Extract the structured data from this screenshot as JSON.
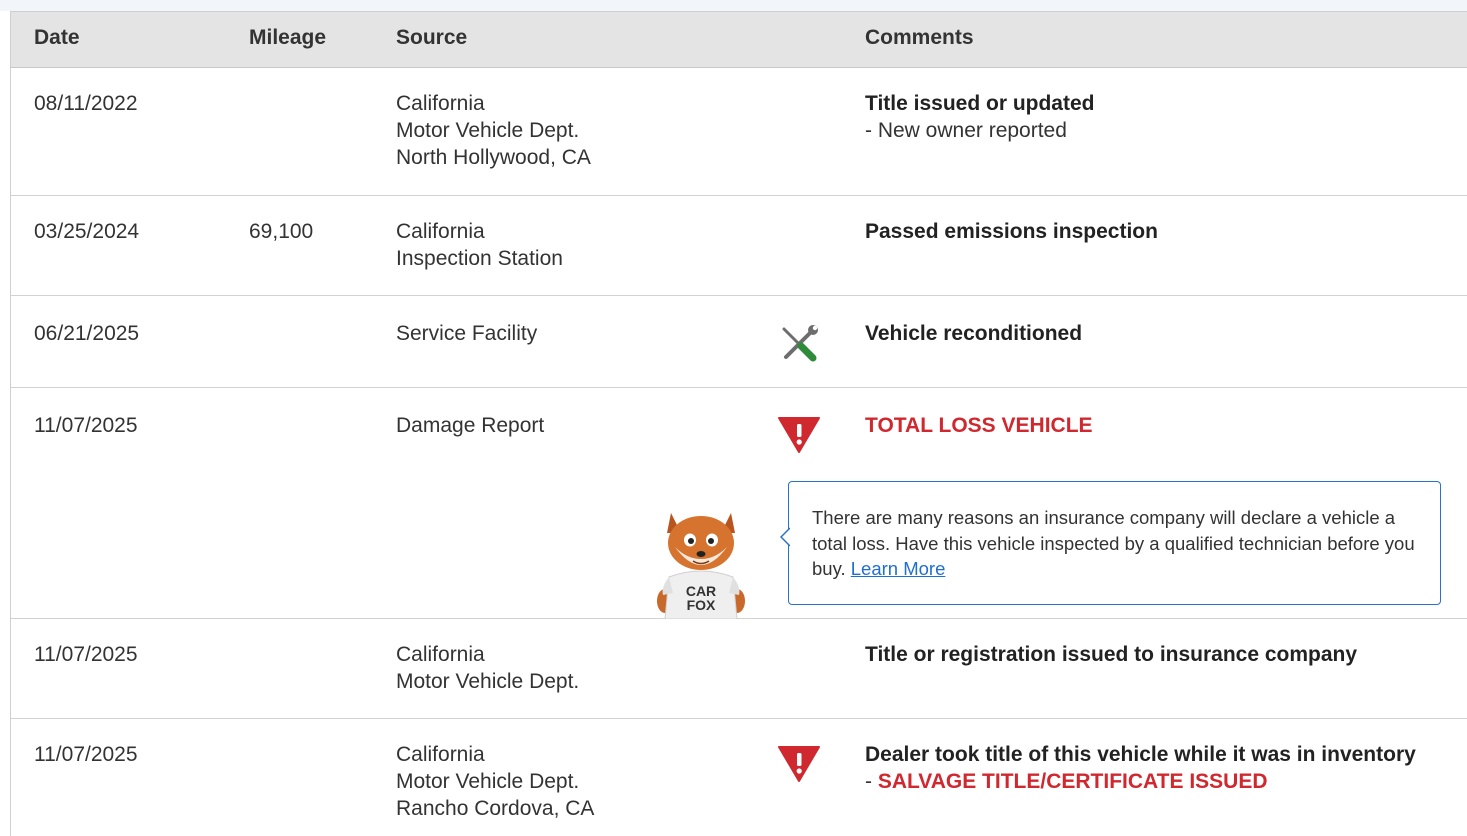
{
  "header": {
    "date": "Date",
    "mileage": "Mileage",
    "source": "Source",
    "comments": "Comments"
  },
  "rows": [
    {
      "date": "08/11/2022",
      "mileage": "",
      "source": [
        "California",
        "Motor Vehicle Dept.",
        "North Hollywood, CA"
      ],
      "icon": "",
      "comment_title": "Title issued or updated",
      "comment_detail": "- New owner reported"
    },
    {
      "date": "03/25/2024",
      "mileage": "69,100",
      "source": [
        "California",
        "Inspection Station"
      ],
      "icon": "",
      "comment_title": "Passed emissions inspection"
    },
    {
      "date": "06/21/2025",
      "mileage": "",
      "source": [
        "Service Facility"
      ],
      "icon": "wrench-screwdriver-icon",
      "comment_title": "Vehicle reconditioned"
    },
    {
      "date": "11/07/2025",
      "mileage": "",
      "source": [
        "Damage Report"
      ],
      "icon": "alert-triangle-icon",
      "comment_title": "TOTAL LOSS VEHICLE",
      "callout": {
        "text": "There are many reasons an insurance company will declare a vehicle a total loss. Have this vehicle inspected by a qualified technician before you buy.",
        "link": "Learn More",
        "mascot_shirt": "CAR FOX"
      }
    },
    {
      "date": "11/07/2025",
      "mileage": "",
      "source": [
        "California",
        "Motor Vehicle Dept."
      ],
      "icon": "",
      "comment_title": "Title or registration issued to insurance company"
    },
    {
      "date": "11/07/2025",
      "mileage": "",
      "source": [
        "California",
        "Motor Vehicle Dept.",
        "Rancho Cordova, CA"
      ],
      "icon": "alert-triangle-icon",
      "comment_title": "Dealer took title of this vehicle while it was in inventory",
      "comment_detail_prefix": "- ",
      "comment_detail_alert": "SALVAGE TITLE/CERTIFICATE ISSUED"
    }
  ],
  "colors": {
    "alert_red": "#d0282f",
    "link_blue": "#1f6fcf",
    "header_bg": "#e4e4e4",
    "wrench_green": "#2e8b3a"
  }
}
